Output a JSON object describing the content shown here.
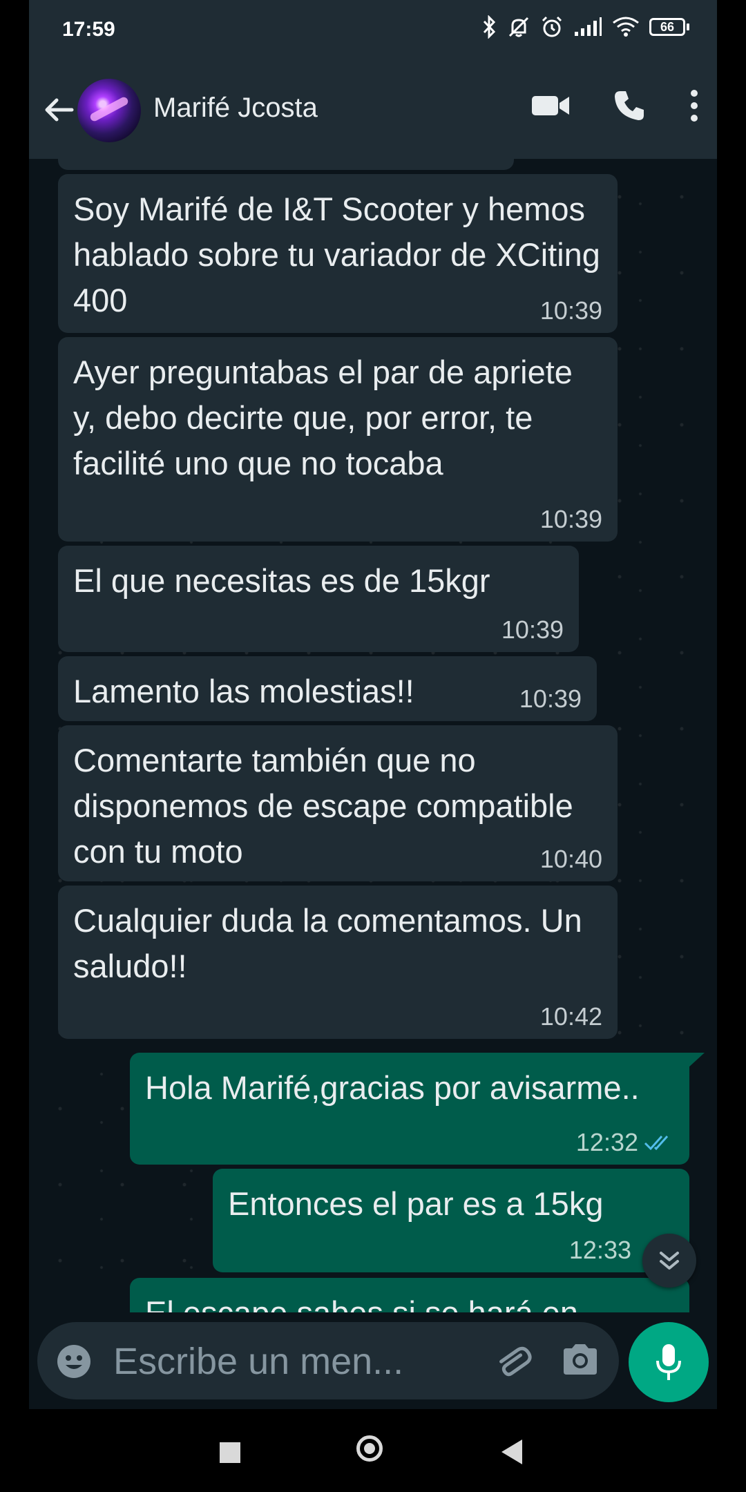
{
  "status_bar": {
    "time": "17:59",
    "battery": "66"
  },
  "header": {
    "contact_name": "Marifé Jcosta"
  },
  "messages": [
    {
      "text": "Soy Marifé de I&T Scooter y hemos hablado sobre tu variador de XCiting 400",
      "time": "10:39",
      "direction": "in"
    },
    {
      "text": "Ayer preguntabas el par de apriete y, debo decirte que, por error, te facilité uno que no tocaba",
      "time": "10:39",
      "direction": "in"
    },
    {
      "text": "El que necesitas es de 15kgr",
      "time": "10:39",
      "direction": "in"
    },
    {
      "text": "Lamento las molestias!!",
      "time": "10:39",
      "direction": "in"
    },
    {
      "text": "Comentarte también que no disponemos de escape compatible con tu moto",
      "time": "10:40",
      "direction": "in"
    },
    {
      "text": "Cualquier duda la comentamos. Un saludo!!",
      "time": "10:42",
      "direction": "in"
    },
    {
      "text": "Hola Marifé,gracias por avisarme..",
      "time": "12:32",
      "direction": "out",
      "status": "read"
    },
    {
      "text": "Entonces el par es a 15kg",
      "time": "12:33",
      "direction": "out"
    },
    {
      "text": "El escape sabes si se hará en",
      "time": "",
      "direction": "out"
    }
  ],
  "composer": {
    "placeholder": "Escribe un men..."
  },
  "colors": {
    "incoming_bubble": "#1f2c34",
    "outgoing_bubble": "#005c4b",
    "accent": "#00a884",
    "read_tick": "#53bdeb"
  }
}
